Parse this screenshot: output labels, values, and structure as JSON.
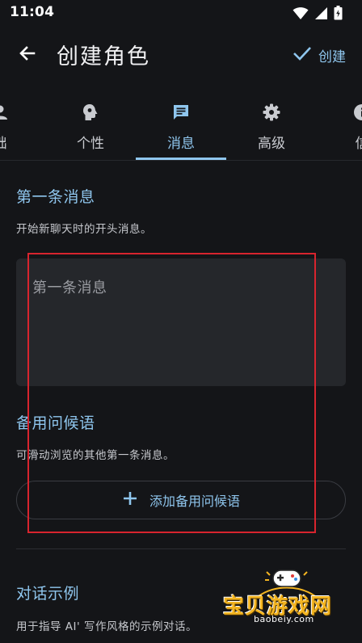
{
  "status_bar": {
    "time": "11:04"
  },
  "header": {
    "title": "创建角色",
    "create_label": "创建"
  },
  "tabs": [
    {
      "label": "础",
      "icon": "person-icon",
      "active": false
    },
    {
      "label": "个性",
      "icon": "head-gear-icon",
      "active": false
    },
    {
      "label": "消息",
      "icon": "message-icon",
      "active": true
    },
    {
      "label": "高级",
      "icon": "gear-icon",
      "active": false
    },
    {
      "label": "信",
      "icon": "info-icon",
      "active": false
    }
  ],
  "first_message": {
    "heading": "第一条消息",
    "description": "开始新聊天时的开头消息。",
    "placeholder": "第一条消息"
  },
  "alt_greetings": {
    "heading": "备用问候语",
    "description": "可滑动浏览的其他第一条消息。",
    "add_button_label": "添加备用问候语"
  },
  "dialogue_examples": {
    "heading": "对话示例",
    "description": "用于指导 AI' 写作风格的示例对话。"
  },
  "watermark": {
    "text": "宝贝游戏网",
    "url": "baobeiy.com"
  },
  "colors": {
    "accent": "#8fc6ee",
    "background": "#141518",
    "field": "#25272b",
    "highlight_box": "#d8242e"
  }
}
